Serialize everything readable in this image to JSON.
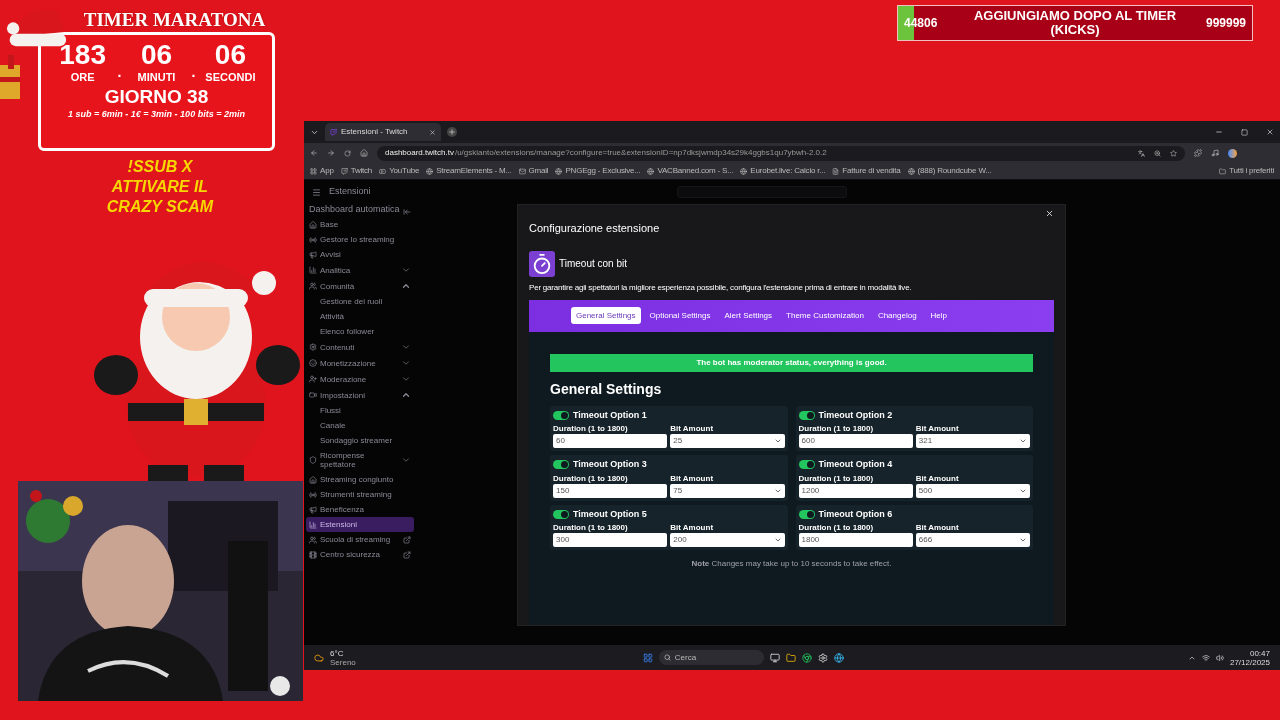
{
  "timer": {
    "title": "TIMER MARATONA",
    "units": [
      {
        "value": "183",
        "label": "ORE"
      },
      {
        "value": "06",
        "label": "MINUTI"
      },
      {
        "value": "06",
        "label": "SECONDI"
      }
    ],
    "separator": ".",
    "day": "GIORNO 38",
    "rates": "1 sub = 6min - 1€ = 3min - 100 bits = 2min"
  },
  "promo": {
    "lines": [
      "!SSUB X",
      "ATTIVARE IL",
      "CRAZY SCAM"
    ]
  },
  "goal_bar": {
    "current": "44806",
    "title": "AGGIUNGIAMO DOPO AL TIMER (KICKS)",
    "target": "999999",
    "level": 0.045
  },
  "browser": {
    "tab": {
      "title": "Estensioni - Twitch",
      "selected": true
    },
    "url_host": "dashboard.twitch.tv",
    "url_path": "/u/gskianto/extensions/manage?configure=true&extensionID=np7dksjwmdp34s29k4ggbs1qu7ybwh-2.0.2",
    "bookmarks": [
      "App",
      "Twitch",
      "YouTube",
      "StreamElements - M...",
      "Gmail",
      "PNGEgg - Exclusive...",
      "VACBanned.com - S...",
      "Eurobet.live: Calcio r...",
      "Fatture di vendita",
      "(888) Roundcube W..."
    ],
    "all_bookmarks": "Tutti i preferiti"
  },
  "page": {
    "title": "Estensioni",
    "sidebar": {
      "heading": "Dashboard automatica",
      "items": [
        {
          "label": "Base",
          "selected": false
        },
        {
          "label": "Gestore lo streaming",
          "selected": false
        },
        {
          "label": "Avvisi",
          "selected": false
        },
        {
          "label": "Analitica",
          "selected": false,
          "expanded": false
        },
        {
          "label": "Comunità",
          "selected": false,
          "expanded": true,
          "children": [
            {
              "label": "Gestione dei ruoli",
              "selected": false
            },
            {
              "label": "Attività",
              "selected": false
            },
            {
              "label": "Elenco follower",
              "selected": false
            }
          ]
        },
        {
          "label": "Contenuti",
          "selected": false,
          "expanded": false
        },
        {
          "label": "Monetizzazione",
          "selected": false,
          "expanded": false
        },
        {
          "label": "Moderazione",
          "selected": false,
          "expanded": false
        },
        {
          "label": "Impostazioni",
          "selected": false,
          "expanded": true,
          "children": [
            {
              "label": "Flussi",
              "selected": false
            },
            {
              "label": "Canale",
              "selected": false
            },
            {
              "label": "Sondaggio streamer",
              "selected": false
            }
          ]
        },
        {
          "label": "Ricompense spettatore",
          "selected": false,
          "expanded": false
        },
        {
          "label": "Streaming congiunto",
          "selected": false
        },
        {
          "label": "Strumenti streaming",
          "selected": false
        },
        {
          "label": "Beneficenza",
          "selected": false
        },
        {
          "label": "Estensioni",
          "selected": true
        },
        {
          "label": "Scuola di streaming",
          "selected": false,
          "external": true
        },
        {
          "label": "Centro sicurezza",
          "selected": false,
          "external": true
        }
      ]
    }
  },
  "dialog": {
    "title": "Configurazione estensione",
    "extension_name": "Timeout con bit",
    "description": "Per garantire agli spettatori la migliore esperienza possibile, configura l'estensione prima di entrare in modalità live.",
    "tabs": [
      {
        "label": "General Settings",
        "selected": true
      },
      {
        "label": "Optional Settings",
        "selected": false
      },
      {
        "label": "Alert Settings",
        "selected": false
      },
      {
        "label": "Theme Customization",
        "selected": false
      },
      {
        "label": "Changelog",
        "selected": false
      },
      {
        "label": "Help",
        "selected": false
      }
    ],
    "status": "The bot has moderator status, everything is good.",
    "heading": "General Settings",
    "options": [
      {
        "title": "Timeout Option 1",
        "on": true,
        "duration_label": "Duration (1 to 1800)",
        "duration": "60",
        "amount_label": "Bit Amount",
        "amount": "25"
      },
      {
        "title": "Timeout Option 2",
        "on": true,
        "duration_label": "Duration (1 to 1800)",
        "duration": "600",
        "amount_label": "Bit Amount",
        "amount": "321"
      },
      {
        "title": "Timeout Option 3",
        "on": true,
        "duration_label": "Duration (1 to 1800)",
        "duration": "150",
        "amount_label": "Bit Amount",
        "amount": "75"
      },
      {
        "title": "Timeout Option 4",
        "on": true,
        "duration_label": "Duration (1 to 1800)",
        "duration": "1200",
        "amount_label": "Bit Amount",
        "amount": "500"
      },
      {
        "title": "Timeout Option 5",
        "on": true,
        "duration_label": "Duration (1 to 1800)",
        "duration": "300",
        "amount_label": "Bit Amount",
        "amount": "200"
      },
      {
        "title": "Timeout Option 6",
        "on": true,
        "duration_label": "Duration (1 to 1800)",
        "duration": "1800",
        "amount_label": "Bit Amount",
        "amount": "666"
      }
    ],
    "note": "**Note** Changes may take up to 10 seconds to take effect."
  },
  "taskbar": {
    "temperature": "6°C",
    "weather": "Sereno",
    "search_placeholder": "Cerca",
    "time": "00:47",
    "date": "27/12/2025"
  }
}
